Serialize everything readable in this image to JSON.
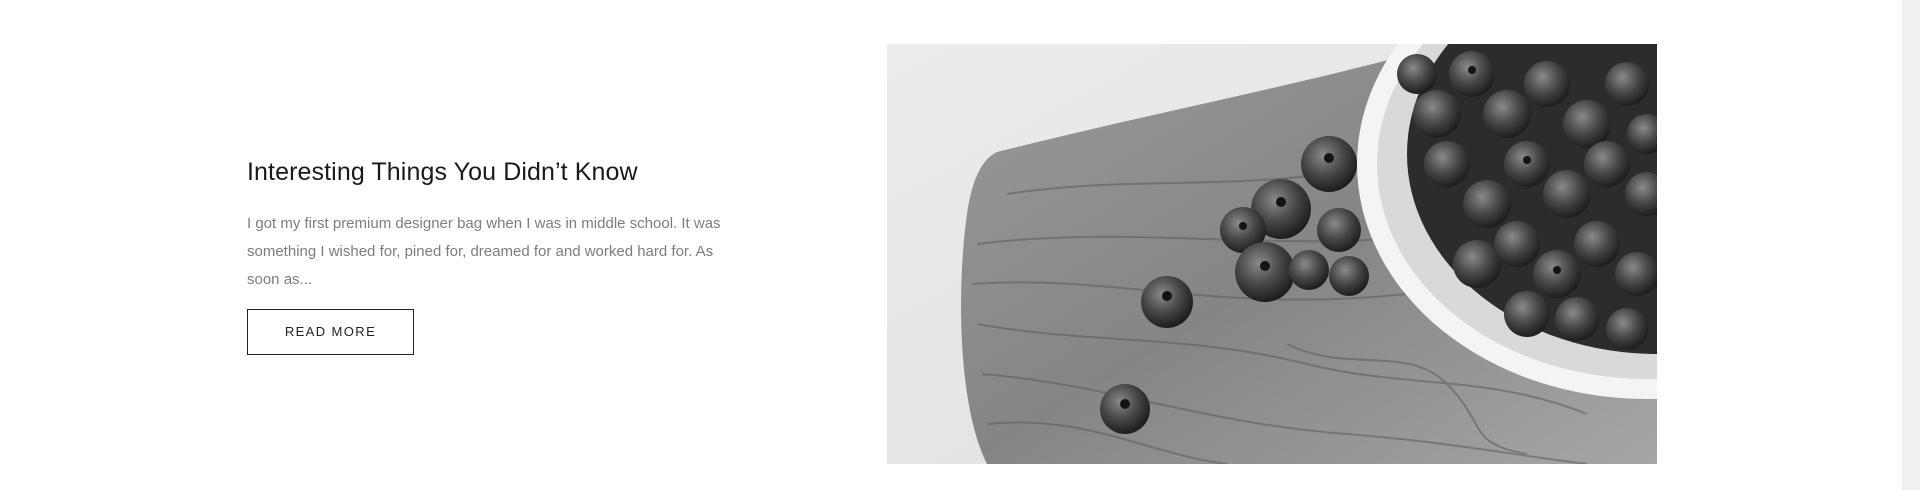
{
  "post": {
    "title": "Interesting Things You Didn’t Know",
    "excerpt": "I got my first premium designer bag when I was in middle school. It was something I wished for, pined for, dreamed for and worked hard for. As soon as...",
    "read_more_label": "READ MORE",
    "image": {
      "description_icon": "blueberries-photo",
      "tone": "grayscale"
    }
  }
}
